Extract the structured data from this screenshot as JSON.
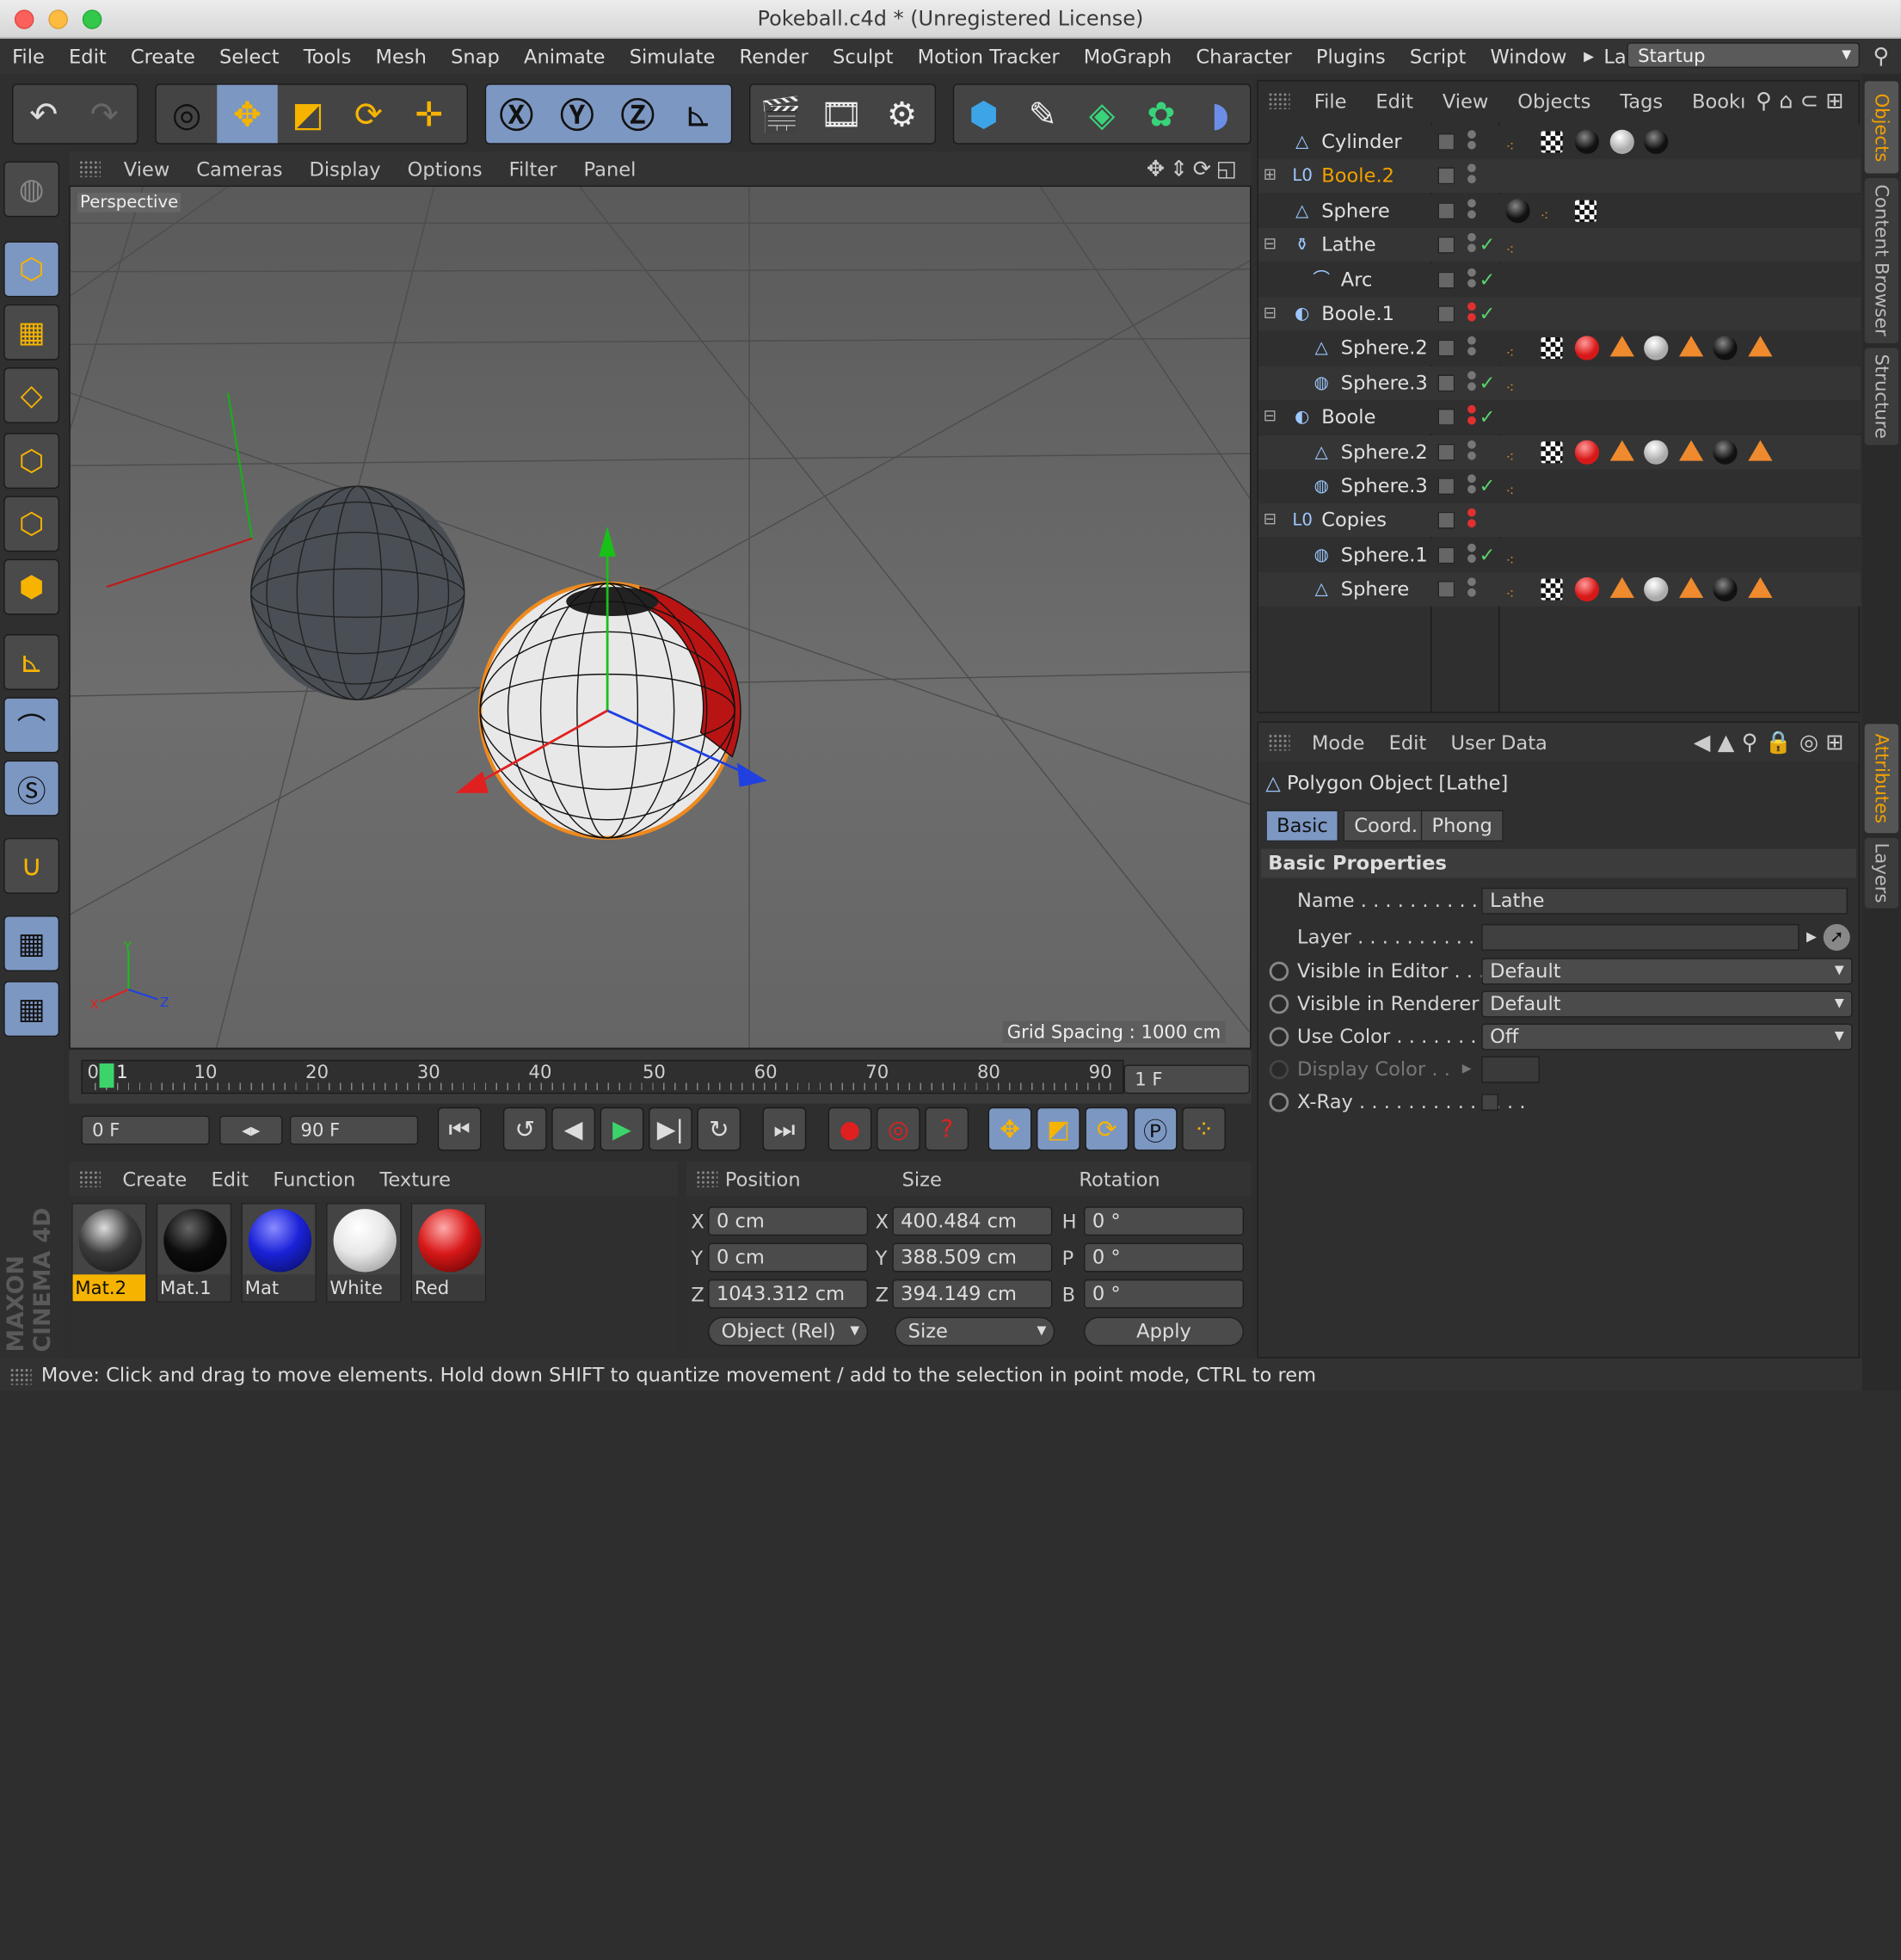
{
  "window": {
    "title": "Pokeball.c4d * (Unregistered License)"
  },
  "menubar": {
    "items": [
      "File",
      "Edit",
      "Create",
      "Select",
      "Tools",
      "Mesh",
      "Snap",
      "Animate",
      "Simulate",
      "Render",
      "Sculpt",
      "Motion Tracker",
      "MoGraph",
      "Character",
      "Plugins",
      "Script",
      "Window"
    ],
    "layout_label": "Layout:",
    "layout_value": "Startup"
  },
  "viewport": {
    "menu": [
      "View",
      "Cameras",
      "Display",
      "Options",
      "Filter",
      "Panel"
    ],
    "camera_label": "Perspective",
    "grid_spacing": "Grid Spacing : 1000 cm"
  },
  "timeline": {
    "ticks": [
      "0",
      "10",
      "20",
      "30",
      "40",
      "50",
      "60",
      "70",
      "80",
      "90"
    ],
    "current_frame_marker": "1",
    "frame_field": "1 F",
    "start_field": "0 F",
    "end_field": "90 F"
  },
  "materials": {
    "menu": [
      "Create",
      "Edit",
      "Function",
      "Texture"
    ],
    "items": [
      {
        "label": "Mat.2",
        "color": "#3a3a3a",
        "selected": true
      },
      {
        "label": "Mat.1",
        "color": "#0c0c0c",
        "selected": false
      },
      {
        "label": "Mat",
        "color": "#1a22d8",
        "selected": false
      },
      {
        "label": "White",
        "color": "#e8e8e8",
        "selected": false
      },
      {
        "label": "Red",
        "color": "#d81818",
        "selected": false
      }
    ]
  },
  "coords": {
    "headers": {
      "position": "Position",
      "size": "Size",
      "rotation": "Rotation"
    },
    "rows": [
      {
        "axis": "X",
        "pos": "0 cm",
        "saxis": "X",
        "size": "400.484 cm",
        "raxis": "H",
        "rot": "0 °"
      },
      {
        "axis": "Y",
        "pos": "0 cm",
        "saxis": "Y",
        "size": "388.509 cm",
        "raxis": "P",
        "rot": "0 °"
      },
      {
        "axis": "Z",
        "pos": "1043.312 cm",
        "saxis": "Z",
        "size": "394.149 cm",
        "raxis": "B",
        "rot": "0 °"
      }
    ],
    "mode": "Object (Rel)",
    "size_mode": "Size",
    "apply": "Apply"
  },
  "status": "Move: Click and drag to move elements. Hold down SHIFT to quantize movement / add to the selection in point mode, CTRL to rem",
  "objects": {
    "menu": [
      "File",
      "Edit",
      "View",
      "Objects",
      "Tags",
      "Bookı"
    ],
    "rows": [
      {
        "name": "Cylinder",
        "indent": 0,
        "icon": "△",
        "orange": false,
        "expand": ""
      },
      {
        "name": "Boole.2",
        "indent": 0,
        "icon": "L0",
        "orange": true,
        "expand": "+"
      },
      {
        "name": "Sphere",
        "indent": 0,
        "icon": "△",
        "orange": false,
        "expand": ""
      },
      {
        "name": "Lathe",
        "indent": 0,
        "icon": "⚱",
        "orange": false,
        "expand": "−"
      },
      {
        "name": "Arc",
        "indent": 1,
        "icon": "⌒",
        "orange": false,
        "expand": ""
      },
      {
        "name": "Boole.1",
        "indent": 0,
        "icon": "◐",
        "orange": false,
        "expand": "−"
      },
      {
        "name": "Sphere.2",
        "indent": 1,
        "icon": "△",
        "orange": false,
        "expand": ""
      },
      {
        "name": "Sphere.3",
        "indent": 1,
        "icon": "◍",
        "orange": false,
        "expand": ""
      },
      {
        "name": "Boole",
        "indent": 0,
        "icon": "◐",
        "orange": false,
        "expand": "−"
      },
      {
        "name": "Sphere.2",
        "indent": 1,
        "icon": "△",
        "orange": false,
        "expand": ""
      },
      {
        "name": "Sphere.3",
        "indent": 1,
        "icon": "◍",
        "orange": false,
        "expand": ""
      },
      {
        "name": "Copies",
        "indent": 0,
        "icon": "L0",
        "orange": false,
        "expand": "−"
      },
      {
        "name": "Sphere.1",
        "indent": 1,
        "icon": "◍",
        "orange": false,
        "expand": ""
      },
      {
        "name": "Sphere",
        "indent": 1,
        "icon": "△",
        "orange": false,
        "expand": ""
      }
    ]
  },
  "attributes": {
    "menu": [
      "Mode",
      "Edit",
      "User Data"
    ],
    "object_title": "Polygon Object [Lathe]",
    "tabs": [
      "Basic",
      "Coord.",
      "Phong"
    ],
    "section": "Basic Properties",
    "name_label": "Name . . . . . . . . . . . . .",
    "name_value": "Lathe",
    "layer_label": "Layer . . . . . . . . . . . . .",
    "visible_editor_label": "Visible in Editor . . .",
    "visible_editor_value": "Default",
    "visible_renderer_label": "Visible in Renderer",
    "visible_renderer_value": "Default",
    "use_color_label": "Use Color . . . . . . . . .",
    "use_color_value": "Off",
    "display_color_label": "Display Color . .",
    "xray_label": "X-Ray . . . . . . . . . . . . . ."
  },
  "side_tabs": [
    "Objects",
    "Content Browser",
    "Structure"
  ],
  "side_tabs2": [
    "Attributes",
    "Layers"
  ],
  "brand": "MAXON CINEMA 4D"
}
